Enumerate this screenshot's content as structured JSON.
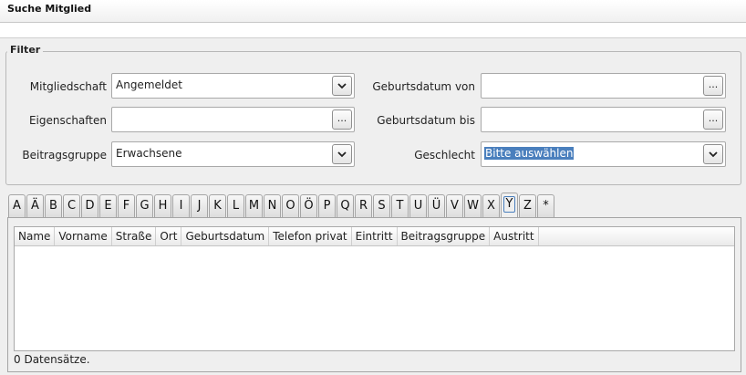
{
  "window": {
    "title": "Suche Mitglied"
  },
  "filter": {
    "legend": "Filter",
    "mitgliedschaft": {
      "label": "Mitgliedschaft",
      "value": "Angemeldet"
    },
    "eigenschaften": {
      "label": "Eigenschaften",
      "value": "",
      "button": "..."
    },
    "beitragsgruppe": {
      "label": "Beitragsgruppe",
      "value": "Erwachsene"
    },
    "geburtsdatum_von": {
      "label": "Geburtsdatum von",
      "value": "",
      "button": "..."
    },
    "geburtsdatum_bis": {
      "label": "Geburtsdatum bis",
      "value": "",
      "button": "..."
    },
    "geschlecht": {
      "label": "Geschlecht",
      "value": "Bitte auswählen"
    }
  },
  "letter_tabs": [
    "A",
    "Ä",
    "B",
    "C",
    "D",
    "E",
    "F",
    "G",
    "H",
    "I",
    "J",
    "K",
    "L",
    "M",
    "N",
    "O",
    "Ö",
    "P",
    "Q",
    "R",
    "S",
    "T",
    "U",
    "Ü",
    "V",
    "W",
    "X",
    "Y",
    "Z",
    "*"
  ],
  "active_tab": "Y",
  "table": {
    "columns": [
      "Name",
      "Vorname",
      "Straße",
      "Ort",
      "Geburtsdatum",
      "Telefon privat",
      "Eintritt",
      "Beitragsgruppe",
      "Austritt"
    ],
    "rows": []
  },
  "status": {
    "text": "0 Datensätze."
  },
  "colors": {
    "selection": "#4a7fbd",
    "background": "#efefef"
  },
  "icons": {
    "dropdown": "chevron-down-icon"
  }
}
